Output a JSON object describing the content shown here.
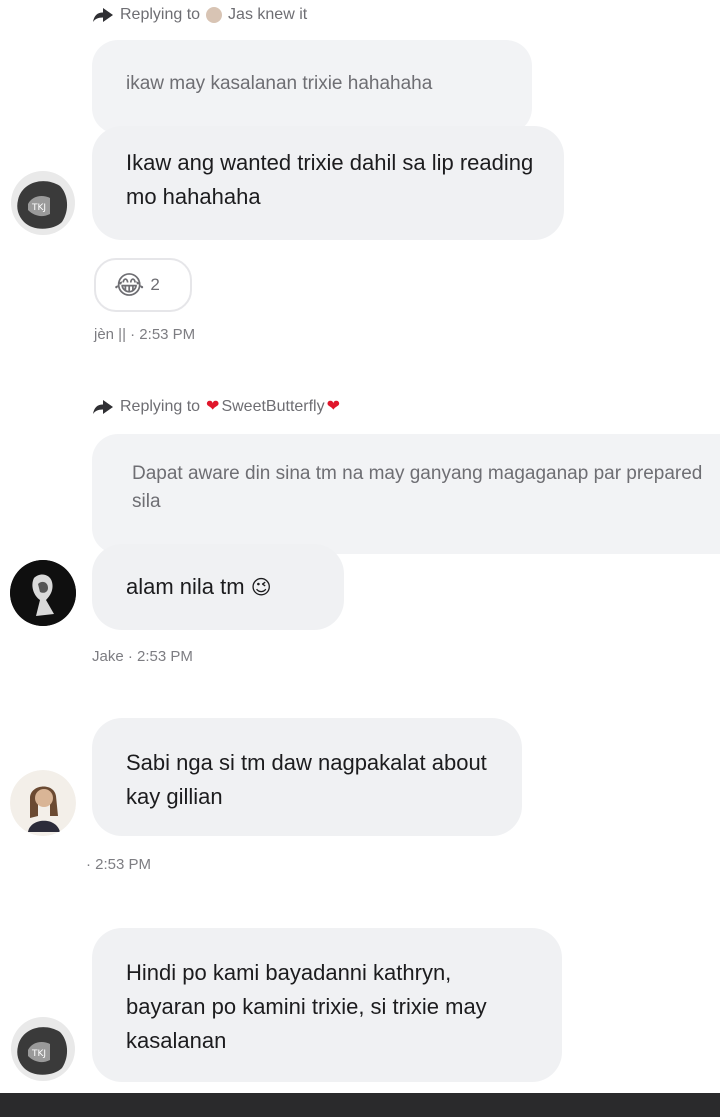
{
  "messages": [
    {
      "reply": {
        "prefix": "Replying to",
        "name": "Jas knew it"
      },
      "quoted": "ikaw may kasalanan trixie hahahaha",
      "text": "Ikaw ang wanted trixie dahil sa lip reading mo hahahaha",
      "reaction": {
        "emoji": "😂",
        "count": "2"
      },
      "meta": "jèn || · 2:53 PM"
    },
    {
      "reply": {
        "prefix": "Replying to",
        "name": "SweetButterfly"
      },
      "quoted": "Dapat aware din sina tm na may ganyang magaganap par prepared sila",
      "text": "alam nila tm",
      "text_emoji": "😉",
      "meta": "Jake · 2:53 PM"
    },
    {
      "text": "Sabi nga si tm daw nagpakalat about kay gillian",
      "meta": "· 2:53 PM"
    },
    {
      "text": "Hindi po kami bayadanni kathryn, bayaran po kamini trixie, si trixie may kasalanan"
    }
  ],
  "colors": {
    "bubble": "#f0f1f3",
    "heart": "#e0162b",
    "meta": "#7d7d82"
  }
}
